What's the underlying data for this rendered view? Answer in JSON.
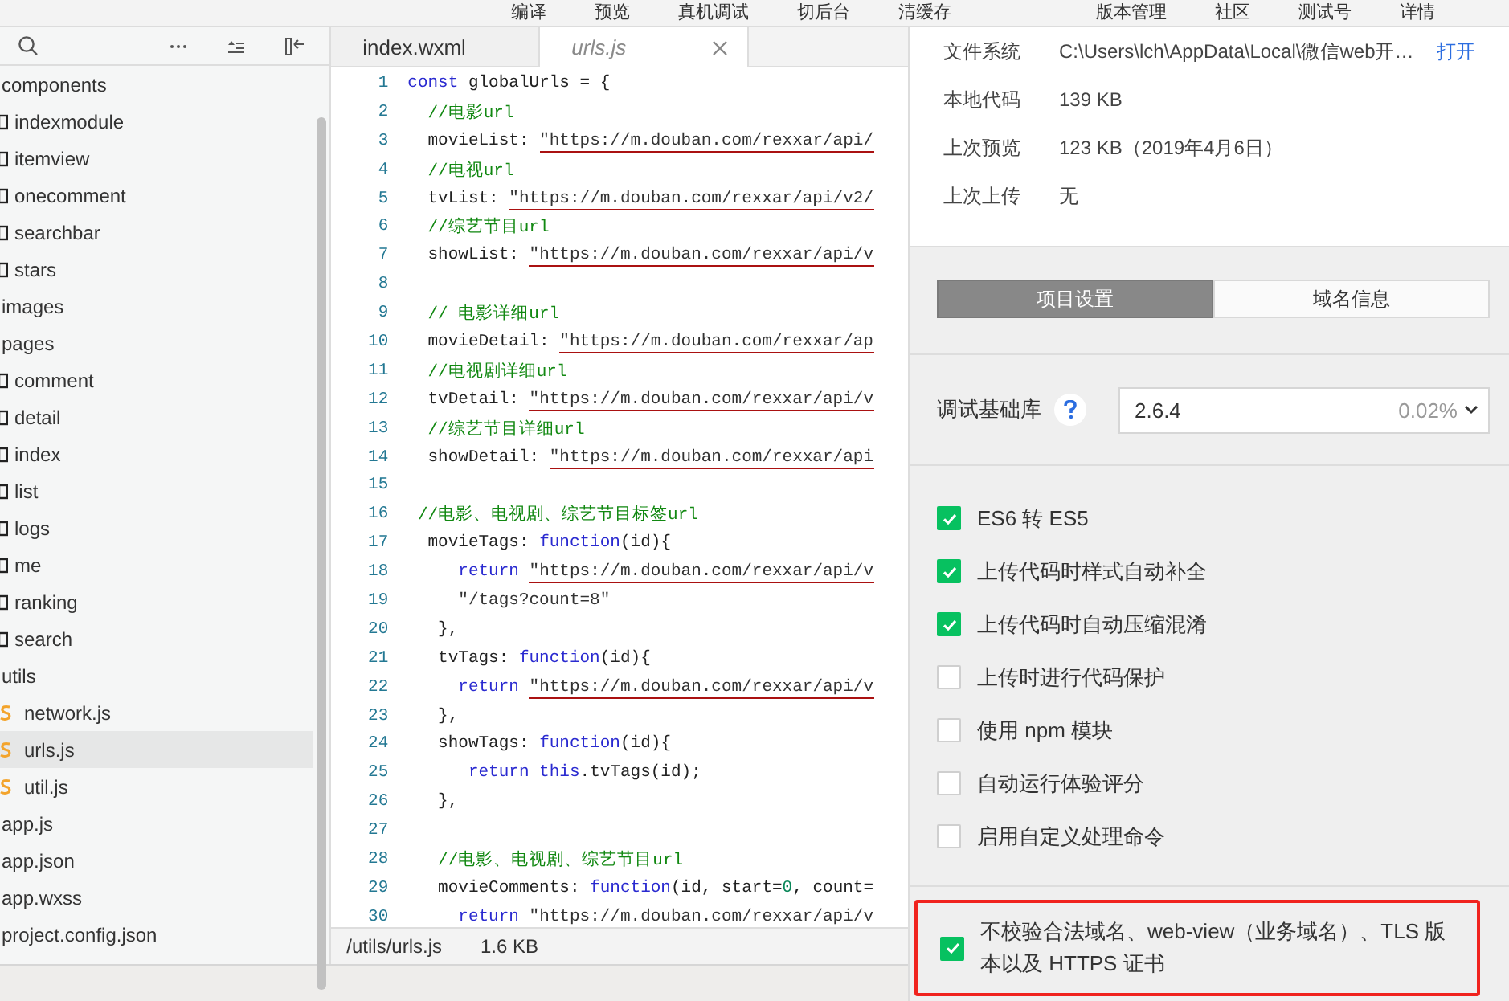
{
  "top_menu": {
    "left": [
      "编译",
      "预览",
      "真机调试",
      "切后台",
      "清缓存"
    ],
    "right": [
      "版本管理",
      "社区",
      "测试号",
      "详情"
    ]
  },
  "sidebar": {
    "tree": [
      {
        "label": "components",
        "selected": false,
        "children": [
          {
            "label": "indexmodule",
            "kind": "folder",
            "selected": false
          },
          {
            "label": "itemview",
            "kind": "folder",
            "selected": false
          },
          {
            "label": "onecomment",
            "kind": "folder",
            "selected": false
          },
          {
            "label": "searchbar",
            "kind": "folder",
            "selected": false
          },
          {
            "label": "stars",
            "kind": "folder",
            "selected": false
          }
        ]
      },
      {
        "label": "images",
        "selected": false
      },
      {
        "label": "pages",
        "selected": false,
        "children": [
          {
            "label": "comment",
            "kind": "folder",
            "selected": false
          },
          {
            "label": "detail",
            "kind": "folder",
            "selected": false
          },
          {
            "label": "index",
            "kind": "folder",
            "selected": false
          },
          {
            "label": "list",
            "kind": "folder",
            "selected": false
          },
          {
            "label": "logs",
            "kind": "folder",
            "selected": false
          },
          {
            "label": "me",
            "kind": "folder",
            "selected": false
          },
          {
            "label": "ranking",
            "kind": "folder",
            "selected": false
          },
          {
            "label": "search",
            "kind": "folder",
            "selected": false
          }
        ]
      },
      {
        "label": "utils",
        "selected": false,
        "children": [
          {
            "label": "network.js",
            "kind": "js",
            "selected": false
          },
          {
            "label": "urls.js",
            "kind": "js",
            "selected": true
          },
          {
            "label": "util.js",
            "kind": "js",
            "selected": false
          }
        ]
      },
      {
        "label": "app.js",
        "selected": false
      },
      {
        "label": "app.json",
        "selected": false
      },
      {
        "label": "app.wxss",
        "selected": false
      },
      {
        "label": "project.config.json",
        "selected": false
      }
    ]
  },
  "editor": {
    "tabs": [
      {
        "label": "index.wxml",
        "selected": false
      },
      {
        "label": "urls.js",
        "selected": true
      }
    ],
    "lines": [
      {
        "number": "1",
        "tokens": [
          {
            "kind": "keyword",
            "text": "const"
          },
          {
            "kind": "plain",
            "text": " globalUrls = {"
          }
        ]
      },
      {
        "number": "2",
        "tokens": [
          {
            "kind": "comment",
            "text": "  //电影url"
          }
        ]
      },
      {
        "number": "3",
        "tokens": [
          {
            "kind": "plain",
            "text": "  movieList: "
          },
          {
            "kind": "url",
            "text": "\"https://m.douban.com/rexxar/api/"
          }
        ]
      },
      {
        "number": "4",
        "tokens": [
          {
            "kind": "comment",
            "text": "  //电视url"
          }
        ]
      },
      {
        "number": "5",
        "tokens": [
          {
            "kind": "plain",
            "text": "  tvList: "
          },
          {
            "kind": "url",
            "text": "\"https://m.douban.com/rexxar/api/v2/"
          }
        ]
      },
      {
        "number": "6",
        "tokens": [
          {
            "kind": "comment",
            "text": "  //综艺节目url"
          }
        ]
      },
      {
        "number": "7",
        "tokens": [
          {
            "kind": "plain",
            "text": "  showList: "
          },
          {
            "kind": "url",
            "text": "\"https://m.douban.com/rexxar/api/v"
          }
        ]
      },
      {
        "number": "8"
      },
      {
        "number": "9",
        "tokens": [
          {
            "kind": "comment",
            "text": "  // 电影详细url"
          }
        ]
      },
      {
        "number": "10",
        "tokens": [
          {
            "kind": "plain",
            "text": "  movieDetail: "
          },
          {
            "kind": "url",
            "text": "\"https://m.douban.com/rexxar/ap"
          }
        ]
      },
      {
        "number": "11",
        "tokens": [
          {
            "kind": "comment",
            "text": "  //电视剧详细url"
          }
        ]
      },
      {
        "number": "12",
        "tokens": [
          {
            "kind": "plain",
            "text": "  tvDetail: "
          },
          {
            "kind": "url",
            "text": "\"https://m.douban.com/rexxar/api/v"
          }
        ]
      },
      {
        "number": "13",
        "tokens": [
          {
            "kind": "comment",
            "text": "  //综艺节目详细url"
          }
        ]
      },
      {
        "number": "14",
        "tokens": [
          {
            "kind": "plain",
            "text": "  showDetail: "
          },
          {
            "kind": "url",
            "text": "\"https://m.douban.com/rexxar/api"
          }
        ]
      },
      {
        "number": "15"
      },
      {
        "number": "16",
        "tokens": [
          {
            "kind": "comment",
            "text": " //电影、电视剧、综艺节目标签url"
          }
        ]
      },
      {
        "number": "17",
        "tokens": [
          {
            "kind": "plain",
            "text": "  movieTags: "
          },
          {
            "kind": "keyword",
            "text": "function"
          },
          {
            "kind": "plain",
            "text": "(id){"
          }
        ]
      },
      {
        "number": "18",
        "tokens": [
          {
            "kind": "keyword",
            "text": "     return "
          },
          {
            "kind": "url",
            "text": "\"https://m.douban.com/rexxar/api/v"
          }
        ]
      },
      {
        "number": "19",
        "tokens": [
          {
            "kind": "string",
            "text": "     \"/tags?count=8\""
          }
        ]
      },
      {
        "number": "20",
        "tokens": [
          {
            "kind": "plain",
            "text": "   },"
          }
        ]
      },
      {
        "number": "21",
        "tokens": [
          {
            "kind": "plain",
            "text": "   tvTags: "
          },
          {
            "kind": "keyword",
            "text": "function"
          },
          {
            "kind": "plain",
            "text": "(id){"
          }
        ]
      },
      {
        "number": "22",
        "tokens": [
          {
            "kind": "keyword",
            "text": "     return "
          },
          {
            "kind": "url",
            "text": "\"https://m.douban.com/rexxar/api/v"
          }
        ]
      },
      {
        "number": "23",
        "tokens": [
          {
            "kind": "plain",
            "text": "   },"
          }
        ]
      },
      {
        "number": "24",
        "tokens": [
          {
            "kind": "plain",
            "text": "   showTags: "
          },
          {
            "kind": "keyword",
            "text": "function"
          },
          {
            "kind": "plain",
            "text": "(id){"
          }
        ]
      },
      {
        "number": "25",
        "tokens": [
          {
            "kind": "keyword",
            "text": "      return this"
          },
          {
            "kind": "plain",
            "text": ".tvTags(id);"
          }
        ]
      },
      {
        "number": "26",
        "tokens": [
          {
            "kind": "plain",
            "text": "   },"
          }
        ]
      },
      {
        "number": "27"
      },
      {
        "number": "28",
        "tokens": [
          {
            "kind": "comment",
            "text": "   //电影、电视剧、综艺节目url"
          }
        ]
      },
      {
        "number": "29",
        "tokens": [
          {
            "kind": "plain",
            "text": "   movieComments: "
          },
          {
            "kind": "keyword",
            "text": "function"
          },
          {
            "kind": "plain",
            "text": "(id, start="
          },
          {
            "kind": "number",
            "text": "0"
          },
          {
            "kind": "plain",
            "text": ", count="
          }
        ]
      },
      {
        "number": "30",
        "tokens": [
          {
            "kind": "keyword",
            "text": "     return "
          },
          {
            "kind": "url",
            "text": "\"https://m.douban.com/rexxar/api/v"
          }
        ]
      }
    ],
    "status": {
      "path": "/utils/urls.js",
      "size": "1.6 KB"
    }
  },
  "details": {
    "info": [
      {
        "label": "文件系统",
        "value": "C:\\Users\\lch\\AppData\\Local\\微信web开…",
        "link": "打开"
      },
      {
        "label": "本地代码",
        "value": "139 KB"
      },
      {
        "label": "上次预览",
        "value": "123 KB（2019年4月6日）"
      },
      {
        "label": "上次上传",
        "value": "无"
      }
    ],
    "tabs": [
      {
        "label": "项目设置",
        "selected": true
      },
      {
        "label": "域名信息",
        "selected": false
      }
    ],
    "library": {
      "label": "调试基础库",
      "value": "2.6.4",
      "share": "0.02%"
    },
    "options": [
      {
        "label": "ES6 转 ES5",
        "checked": true
      },
      {
        "label": "上传代码时样式自动补全",
        "checked": true
      },
      {
        "label": "上传代码时自动压缩混淆",
        "checked": true
      },
      {
        "label": "上传时进行代码保护",
        "checked": false
      },
      {
        "label": "使用 npm 模块",
        "checked": false
      },
      {
        "label": "自动运行体验评分",
        "checked": false
      },
      {
        "label": "启用自定义处理命令",
        "checked": false
      }
    ],
    "highlighted_option": {
      "label": "不校验合法域名、web-view（业务域名）、TLS 版本以及 HTTPS 证书",
      "checked": true
    }
  }
}
